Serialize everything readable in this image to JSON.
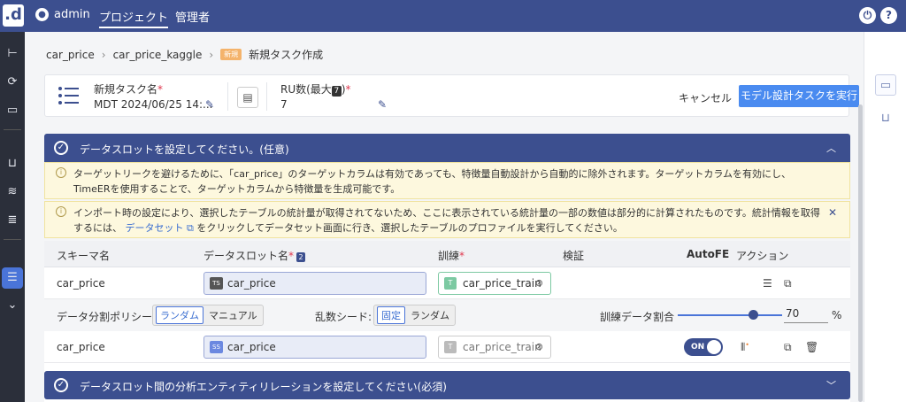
{
  "topbar": {
    "logo": ".d",
    "user": "admin",
    "nav": [
      "プロジェクト",
      "管理者"
    ]
  },
  "breadcrumb": {
    "items": [
      "car_price",
      "car_price_kaggle"
    ],
    "badge": "新規",
    "current": "新規タスク作成"
  },
  "task": {
    "name_label": "新規タスク名",
    "name_value": "MDT 2024/06/25 14:...",
    "ru_label": "RU数(最大",
    "ru_badge": "7",
    "ru_label_end": ")",
    "ru_value": "7",
    "cancel": "キャンセル",
    "run": "モデル設計タスクを実行"
  },
  "panel1": {
    "title": "データスロットを設定してください。(任意)"
  },
  "alerts": {
    "a1": "ターゲットリークを避けるために、「car_price」のターゲットカラムは有効であっても、特徴量自動設計から自動的に除外されます。ターゲットカラムを有効にし、TimeERを使用することで、ターゲットカラムから特徴量を生成可能です。",
    "a2_pre": "インポート時の設定により、選択したテーブルの統計量が取得されてないため、ここに表示されている統計量の一部の数値は部分的に計算されたものです。統計情報を取得するには、",
    "a2_link": "データセット",
    "a2_post": "をクリックしてデータセット画面に行き、選択したテーブルのプロファイルを実行してください。"
  },
  "table": {
    "headers": {
      "schema": "スキーマ名",
      "slot": "データスロット名",
      "slot_badge": "2",
      "train": "訓練",
      "verify": "検証",
      "autofe": "AutoFE",
      "action": "アクション"
    },
    "rows": [
      {
        "schema": "car_price",
        "slot_tag": "TS",
        "slot": "car_price",
        "train_tag": "T",
        "train": "car_price_train"
      },
      {
        "schema": "car_price",
        "slot_tag": "SS",
        "slot": "car_price",
        "train_tag": "T",
        "train": "car_price_train",
        "autofe": "ON"
      }
    ],
    "policy": {
      "label": "データ分割ポリシー",
      "options": [
        "ランダム",
        "マニュアル"
      ],
      "seed_label": "乱数シード:",
      "seed_options": [
        "固定",
        "ランダム"
      ],
      "ratio_label": "訓練データ割合",
      "ratio_value": "70",
      "ratio_unit": "%",
      "ratio": 0.7
    }
  },
  "panel2": {
    "title": "データスロット間の分析エンティティリレーションを設定してください(必須)"
  },
  "colors": {
    "primary": "#3c4f8f",
    "button": "#4a8bf0",
    "alert": "#fdf8de",
    "required": "#e0384e"
  }
}
